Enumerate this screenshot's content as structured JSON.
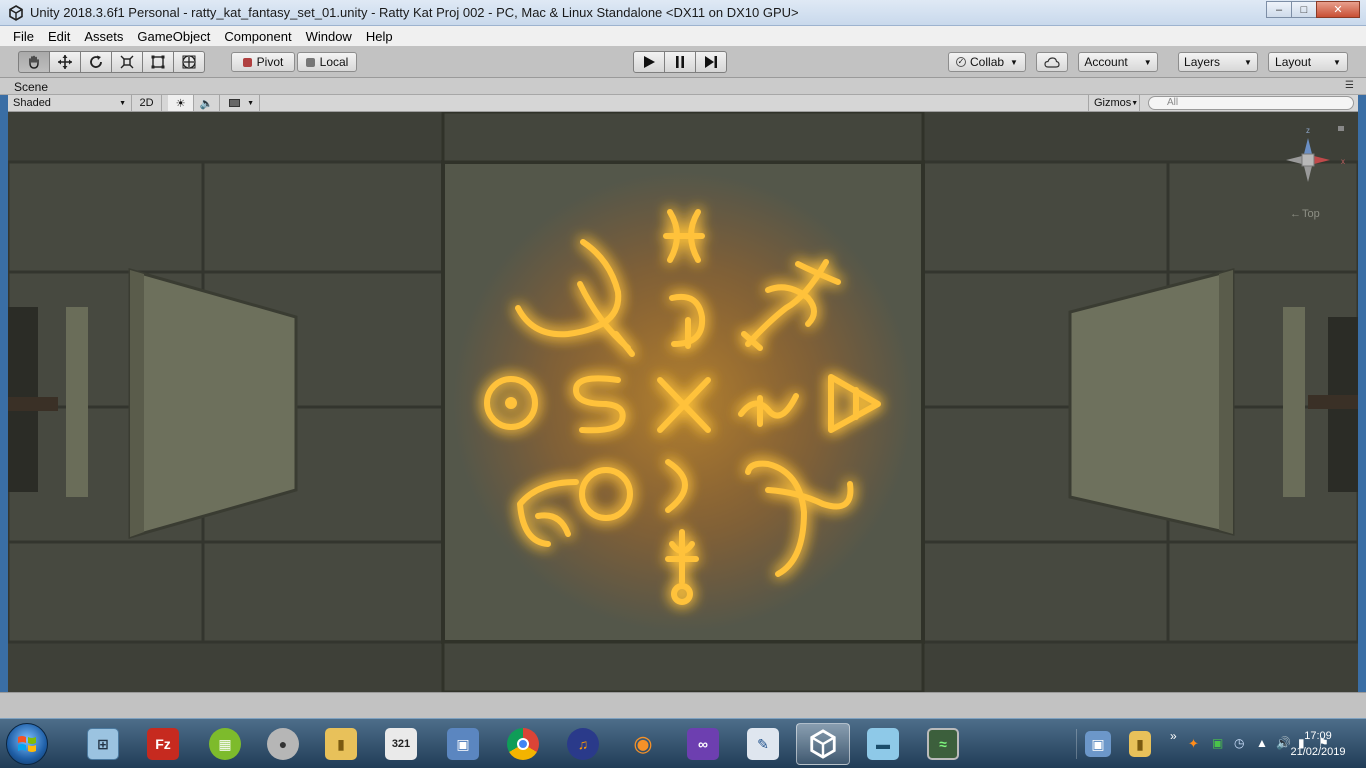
{
  "window": {
    "title": "Unity 2018.3.6f1 Personal - ratty_kat_fantasy_set_01.unity - Ratty Kat Proj 002 - PC, Mac & Linux Standalone <DX11 on DX10 GPU>"
  },
  "menu": [
    "File",
    "Edit",
    "Assets",
    "GameObject",
    "Component",
    "Window",
    "Help"
  ],
  "toolbar": {
    "tools": [
      "hand-icon",
      "move-icon",
      "rotate-icon",
      "scale-icon",
      "rect-icon",
      "transform-icon"
    ],
    "pivot_label": "Pivot",
    "local_label": "Local",
    "collab_label": "Collab",
    "account_label": "Account",
    "layers_label": "Layers",
    "layout_label": "Layout"
  },
  "scene": {
    "tab_label": "Scene",
    "shading_mode": "Shaded",
    "mode_2d": "2D",
    "gizmos_label": "Gizmos",
    "search_placeholder": "All",
    "view_label": "Top"
  },
  "taskbar": {
    "apps": [
      "calculator-icon",
      "filezilla-icon",
      "green-app-icon",
      "speaker-app-icon",
      "folder-app-icon",
      "clapper-icon",
      "remote-desktop-icon",
      "chrome-icon",
      "headphones-icon",
      "blender-icon",
      "visual-studio-icon",
      "editor-icon",
      "unity-icon",
      "notepad-icon",
      "monitor-icon"
    ],
    "active_app": "unity-icon",
    "clock_time": "17:09",
    "clock_date": "21/02/2019"
  },
  "colors": {
    "glow": "#ffb020",
    "glow_outer": "#ff6a00",
    "floor": "#4a4c40",
    "close_button": "#c84f34"
  }
}
